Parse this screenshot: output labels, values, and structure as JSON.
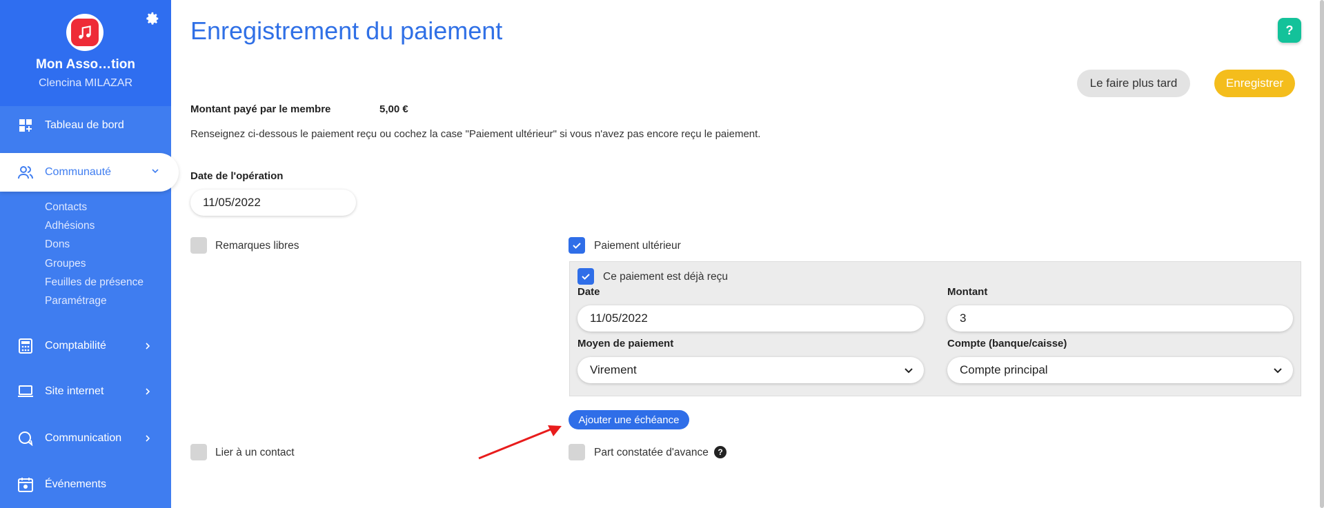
{
  "sidebar": {
    "org_name": "Mon Asso…tion",
    "user_name": "Clencina MILAZAR",
    "items": [
      {
        "label": "Tableau de bord",
        "icon": "dashboard-icon"
      },
      {
        "label": "Communauté",
        "icon": "community-icon"
      },
      {
        "label": "Comptabilité",
        "icon": "calculator-icon"
      },
      {
        "label": "Site internet",
        "icon": "laptop-icon"
      },
      {
        "label": "Communication",
        "icon": "chat-icon"
      },
      {
        "label": "Événements",
        "icon": "calendar-icon"
      }
    ],
    "subitems": [
      "Contacts",
      "Adhésions",
      "Dons",
      "Groupes",
      "Feuilles de présence",
      "Paramétrage"
    ]
  },
  "header": {
    "title": "Enregistrement du paiement",
    "help": "?"
  },
  "actions": {
    "later": "Le faire plus tard",
    "save": "Enregistrer"
  },
  "payment": {
    "amount_label": "Montant payé par le membre",
    "amount_value": "5,00 €",
    "instructions": "Renseignez ci-dessous le paiement reçu ou cochez la case \"Paiement ultérieur\" si vous n'avez pas encore reçu le paiement.",
    "operation_date_label": "Date de l'opération",
    "operation_date": "11/05/2022"
  },
  "options": {
    "remarks": "Remarques libres",
    "later_payment": "Paiement ultérieur",
    "already_received": "Ce paiement est déjà reçu",
    "link_contact": "Lier à un contact",
    "deferred_part": "Part constatée d'avance"
  },
  "panel": {
    "date_label": "Date",
    "date_value": "11/05/2022",
    "amount_label": "Montant",
    "amount_value": "3",
    "method_label": "Moyen de paiement",
    "method_value": "Virement",
    "account_label": "Compte (banque/caisse)",
    "account_value": "Compte principal"
  },
  "add_schedule": "Ajouter une échéance",
  "colors": {
    "sidebar": "#3f7df0",
    "accent": "#2f6ee8",
    "save": "#f4bd1c",
    "help": "#13c29a",
    "annotation_arrow": "#e81c1c"
  }
}
